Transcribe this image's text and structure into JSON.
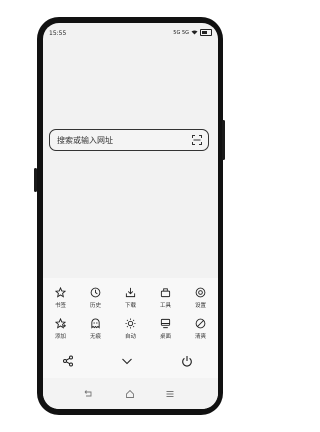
{
  "status": {
    "time": "15:55",
    "signal_text": "5G 5G"
  },
  "search": {
    "placeholder": "搜索或输入网址"
  },
  "menu": {
    "row1": [
      {
        "label": "书签",
        "icon": "star-icon"
      },
      {
        "label": "历史",
        "icon": "clock-icon"
      },
      {
        "label": "下载",
        "icon": "download-icon"
      },
      {
        "label": "工具",
        "icon": "toolbox-icon"
      },
      {
        "label": "设置",
        "icon": "settings-icon"
      }
    ],
    "row2": [
      {
        "label": "添加",
        "icon": "add-star-icon"
      },
      {
        "label": "无痕",
        "icon": "incognito-icon"
      },
      {
        "label": "自动",
        "icon": "brightness-icon"
      },
      {
        "label": "桌面",
        "icon": "desktop-icon"
      },
      {
        "label": "清爽",
        "icon": "no-ads-icon"
      }
    ],
    "bottom": {
      "share": "share-icon",
      "collapse": "chevron-down-icon",
      "exit": "power-icon"
    }
  },
  "navbar": {
    "back": "back-icon",
    "home": "home-icon",
    "menu": "menu-icon"
  }
}
